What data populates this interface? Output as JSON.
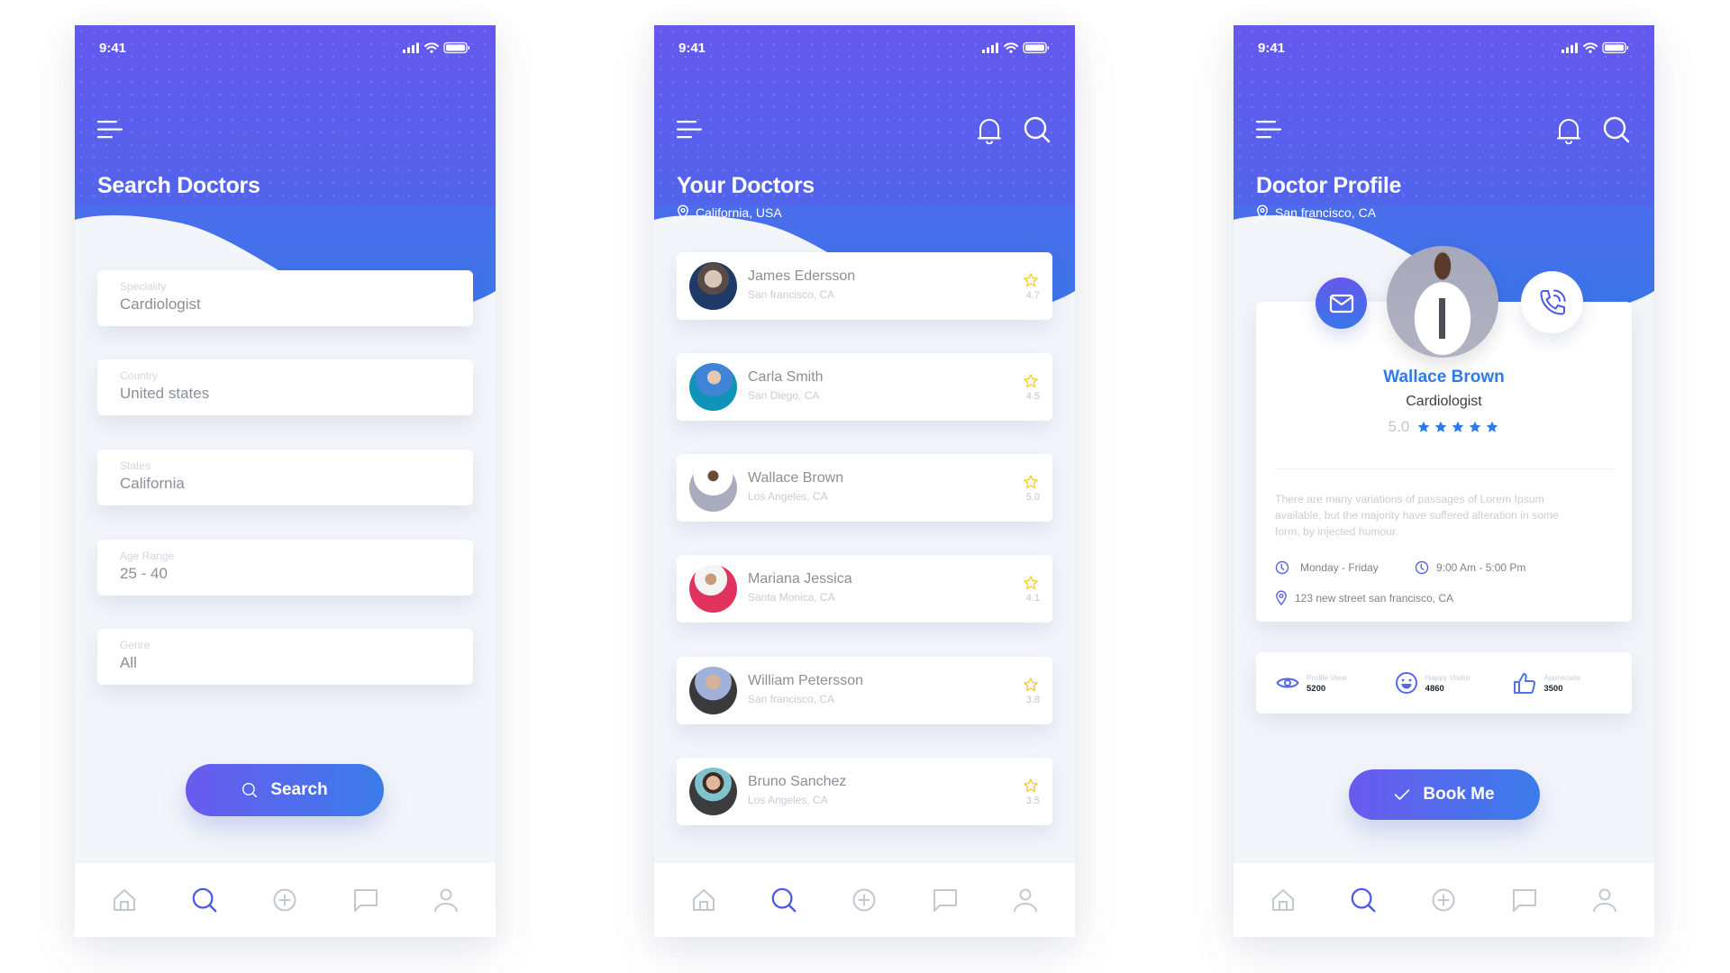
{
  "colors": {
    "gradient_start": "#6558ee",
    "gradient_end": "#3a76ea",
    "accent_blue": "#2f7aea",
    "star_yellow": "#f7c934",
    "nav_active": "#4a5ae8",
    "nav_inactive": "#c2c8d0",
    "background": "#f2f5fa"
  },
  "status_bar": {
    "time": "9:41"
  },
  "screens": {
    "search": {
      "title": "Search Doctors",
      "fields": [
        {
          "label": "Speciality",
          "value": "Cardiologist"
        },
        {
          "label": "Country",
          "value": "United states"
        },
        {
          "label": "States",
          "value": "California"
        },
        {
          "label": "Age Range",
          "value": "25 - 40"
        },
        {
          "label": "Genre",
          "value": "All"
        }
      ],
      "search_button": "Search"
    },
    "list": {
      "title": "Your Doctors",
      "location": "California, USA",
      "doctors": [
        {
          "name": "James Edersson",
          "location": "San francisco, CA",
          "rating": "4.7"
        },
        {
          "name": "Carla Smith",
          "location": "San Diego, CA",
          "rating": "4.5"
        },
        {
          "name": "Wallace Brown",
          "location": "Los Angeles, CA",
          "rating": "5.0"
        },
        {
          "name": "Mariana Jessica",
          "location": "Santa Monica, CA",
          "rating": "4.1"
        },
        {
          "name": "William Petersson",
          "location": "San francisco, CA",
          "rating": "3.8"
        },
        {
          "name": "Bruno Sanchez",
          "location": "Los Angeles, CA",
          "rating": "3.5"
        }
      ]
    },
    "profile": {
      "title": "Doctor Profile",
      "location": "San francisco, CA",
      "name": "Wallace Brown",
      "speciality": "Cardiologist",
      "rating": "5.0",
      "stars": 5,
      "bio": "There are many variations of passages of Lorem Ipsum available, but the majority have suffered alteration in some form, by injected humour.",
      "days": "Monday - Friday",
      "hours": "9:00 Am - 5:00 Pm",
      "address": "123 new street san francisco, CA",
      "stats": [
        {
          "label": "Profile View",
          "value": "5200",
          "icon": "eye-icon"
        },
        {
          "label": "Happy Visitor",
          "value": "4860",
          "icon": "smiley-icon"
        },
        {
          "label": "Appreciate",
          "value": "3500",
          "icon": "thumbs-up-icon"
        }
      ],
      "book_button": "Book Me"
    }
  },
  "bottom_nav": [
    {
      "name": "home",
      "icon": "home-icon",
      "active": false
    },
    {
      "name": "search",
      "icon": "search-icon",
      "active": true
    },
    {
      "name": "add",
      "icon": "plus-circle-icon",
      "active": false
    },
    {
      "name": "messages",
      "icon": "chat-icon",
      "active": false
    },
    {
      "name": "profile",
      "icon": "user-icon",
      "active": false
    }
  ]
}
